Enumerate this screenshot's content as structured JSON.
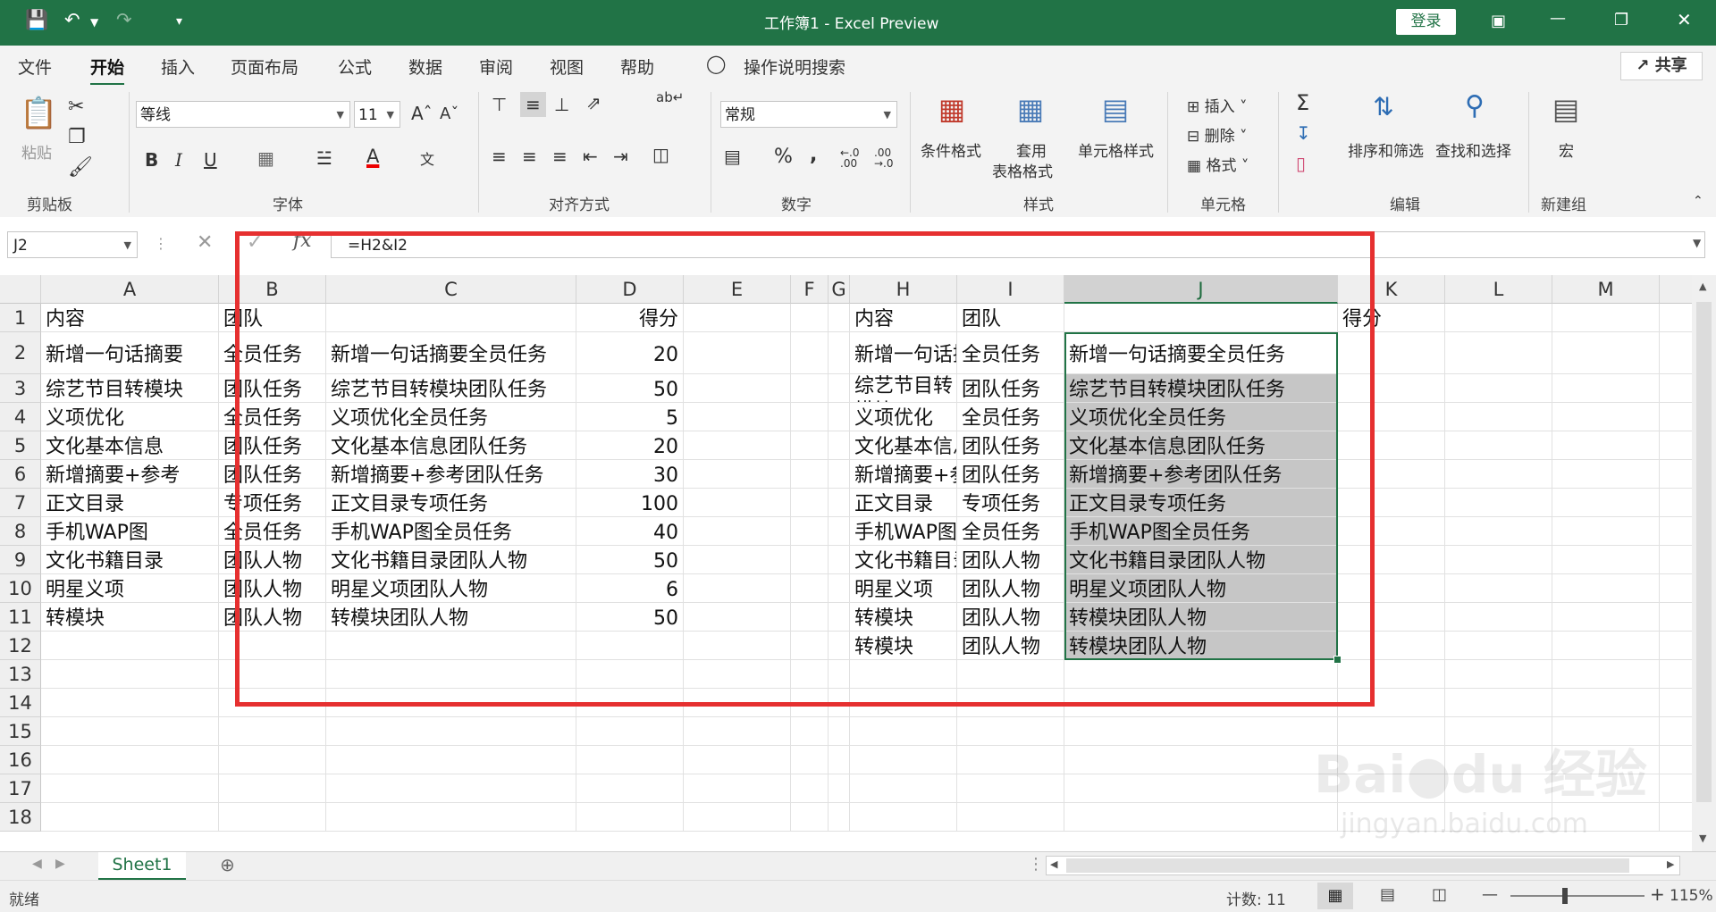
{
  "app": {
    "title": "工作簿1  -  Excel Preview",
    "login_label": "登录",
    "share_label": "共享"
  },
  "ribbon_tabs": [
    "文件",
    "开始",
    "插入",
    "页面布局",
    "公式",
    "数据",
    "审阅",
    "视图",
    "帮助"
  ],
  "ribbon_search": "操作说明搜索",
  "ribbon": {
    "paste_label": "粘贴",
    "font_name": "等线",
    "font_size": "11",
    "number_format": "常规",
    "conditional_format": "条件格式",
    "table_format_line1": "套用",
    "table_format_line2": "表格格式",
    "cell_styles": "单元格样式",
    "insert": "插入",
    "delete": "删除",
    "format": "格式",
    "sort_filter": "排序和筛选",
    "find_select": "查找和选择",
    "macro": "宏",
    "groups": {
      "clipboard": "剪贴板",
      "font": "字体",
      "alignment": "对齐方式",
      "number": "数字",
      "styles": "样式",
      "cells": "单元格",
      "editing": "编辑",
      "new_group": "新建组"
    }
  },
  "formula_bar": {
    "name_box": "J2",
    "formula": "=H2&I2"
  },
  "columns": [
    "A",
    "B",
    "C",
    "D",
    "E",
    "F",
    "G",
    "H",
    "I",
    "J",
    "K",
    "L",
    "M"
  ],
  "rows": [
    "1",
    "2",
    "3",
    "4",
    "5",
    "6",
    "7",
    "8",
    "9",
    "10",
    "11",
    "12",
    "13",
    "14",
    "15",
    "16",
    "17",
    "18"
  ],
  "cells": {
    "A1": "内容",
    "B1": "团队",
    "D1": "得分",
    "H1": "内容",
    "I1": "团队",
    "K1": "得分",
    "A2": "新增一句话摘要",
    "B2": "全员任务",
    "C2": "新增一句话摘要全员任务",
    "D2": "20",
    "H2": "新增一句话摘要",
    "I2": "全员任务",
    "J2": "新增一句话摘要全员任务",
    "A3": "综艺节目转模块",
    "B3": "团队任务",
    "C3": "综艺节目转模块团队任务",
    "D3": "50",
    "H3": "综艺节目转模块",
    "I3": "团队任务",
    "J3": "综艺节目转模块团队任务",
    "A4": "义项优化",
    "B4": "全员任务",
    "C4": "义项优化全员任务",
    "D4": "5",
    "H4": "义项优化",
    "I4": "全员任务",
    "J4": "义项优化全员任务",
    "A5": "文化基本信息",
    "B5": "团队任务",
    "C5": "文化基本信息团队任务",
    "D5": "20",
    "H5": "文化基本信息",
    "I5": "团队任务",
    "J5": "文化基本信息团队任务",
    "A6": "新增摘要+参考",
    "B6": "团队任务",
    "C6": "新增摘要+参考团队任务",
    "D6": "30",
    "H6": "新增摘要+参考",
    "I6": "团队任务",
    "J6": "新增摘要+参考团队任务",
    "A7": "正文目录",
    "B7": "专项任务",
    "C7": "正文目录专项任务",
    "D7": "100",
    "H7": "正文目录",
    "I7": "专项任务",
    "J7": "正文目录专项任务",
    "A8": "手机WAP图",
    "B8": "全员任务",
    "C8": "手机WAP图全员任务",
    "D8": "40",
    "H8": "手机WAP图",
    "I8": "全员任务",
    "J8": "手机WAP图全员任务",
    "A9": "文化书籍目录",
    "B9": "团队人物",
    "C9": "文化书籍目录团队人物",
    "D9": "50",
    "H9": "文化书籍目录",
    "I9": "团队人物",
    "J9": "文化书籍目录团队人物",
    "A10": "明星义项",
    "B10": "团队人物",
    "C10": "明星义项团队人物",
    "D10": "6",
    "H10": "明星义项",
    "I10": "团队人物",
    "J10": "明星义项团队人物",
    "A11": "转模块",
    "B11": "团队人物",
    "C11": "转模块团队人物",
    "D11": "50",
    "H11": "转模块",
    "I11": "团队人物",
    "J11": "转模块团队人物",
    "H12": "转模块",
    "I12": "团队人物",
    "J12": "转模块团队人物"
  },
  "sheet_tab": "Sheet1",
  "status": {
    "mode": "就绪",
    "count": "计数: 11",
    "zoom": "115%"
  },
  "watermark": "jingyan.baidu.com",
  "colors": {
    "excel_green": "#217346",
    "highlight_red": "#e63030",
    "selection_gray": "#c6c6c6"
  }
}
